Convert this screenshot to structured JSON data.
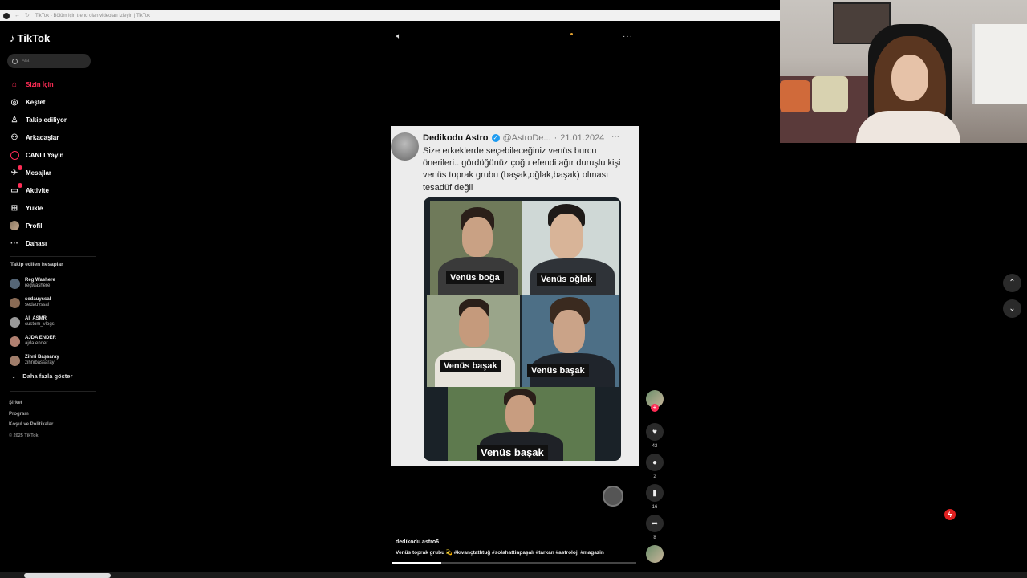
{
  "browser": {
    "title": "TikTok - Bölüm için trend olan videoları izleyin | TikTok"
  },
  "sidebar": {
    "logo": "TikTok",
    "search_placeholder": "Ara",
    "items": [
      {
        "label": "Sizin İçin",
        "icon": "home-icon",
        "active": true
      },
      {
        "label": "Keşfet",
        "icon": "compass-icon"
      },
      {
        "label": "Takip ediliyor",
        "icon": "following-icon"
      },
      {
        "label": "Arkadaşlar",
        "icon": "friends-icon"
      },
      {
        "label": "CANLI Yayın",
        "icon": "live-icon"
      },
      {
        "label": "Mesajlar",
        "icon": "messages-icon",
        "badge": true
      },
      {
        "label": "Aktivite",
        "icon": "activity-icon",
        "badge": true
      },
      {
        "label": "Yükle",
        "icon": "upload-icon"
      },
      {
        "label": "Profil",
        "icon": "profile-icon"
      },
      {
        "label": "Dahası",
        "icon": "more-icon"
      }
    ],
    "following_title": "Takip edilen hesaplar",
    "following": [
      {
        "name": "Reg Washere",
        "handle": "regwashere",
        "color": "#556677"
      },
      {
        "name": "sedauyssal",
        "handle": "sedauyssal",
        "color": "#8a6b55"
      },
      {
        "name": "AI_ASMR",
        "handle": "custom_vlogs",
        "color": "#999999"
      },
      {
        "name": "AJDA ENDER",
        "handle": "ajda.ender",
        "color": "#b08070"
      },
      {
        "name": "Zihni Başsaray",
        "handle": "zihnibassaray",
        "color": "#a07d6a"
      }
    ],
    "show_more": "Daha fazla göster",
    "footer": [
      "Şirket",
      "Program",
      "Koşul ve Politikalar"
    ],
    "copyright": "© 2025 TikTok"
  },
  "tweet": {
    "author": "Dedikodu Astro",
    "handle": "@AstroDe...",
    "date": "21.01.2024",
    "text": "Size erkeklerde seçebileceğiniz venüs burcu önerileri.. gördüğünüz çoğu efendi ağır duruşlu kişi venüs toprak grubu (başak,oğlak,başak) olması tesadüf değil",
    "labels": [
      "Venüs boğa",
      "Venüs oğlak",
      "Venüs başak",
      "Venüs başak",
      "Venüs başak"
    ]
  },
  "actions": {
    "likes": "42",
    "comments": "2",
    "saves": "16",
    "shares": "8"
  },
  "caption": {
    "user": "dedikodu.astro6",
    "desc": "Venüs toprak grubu 💫  #kıvançtatlıtuğ #solahattinpaşalı #tarkan #astroloji #magazin"
  },
  "colors": {
    "accent": "#fe2c55",
    "background": "#000000"
  }
}
